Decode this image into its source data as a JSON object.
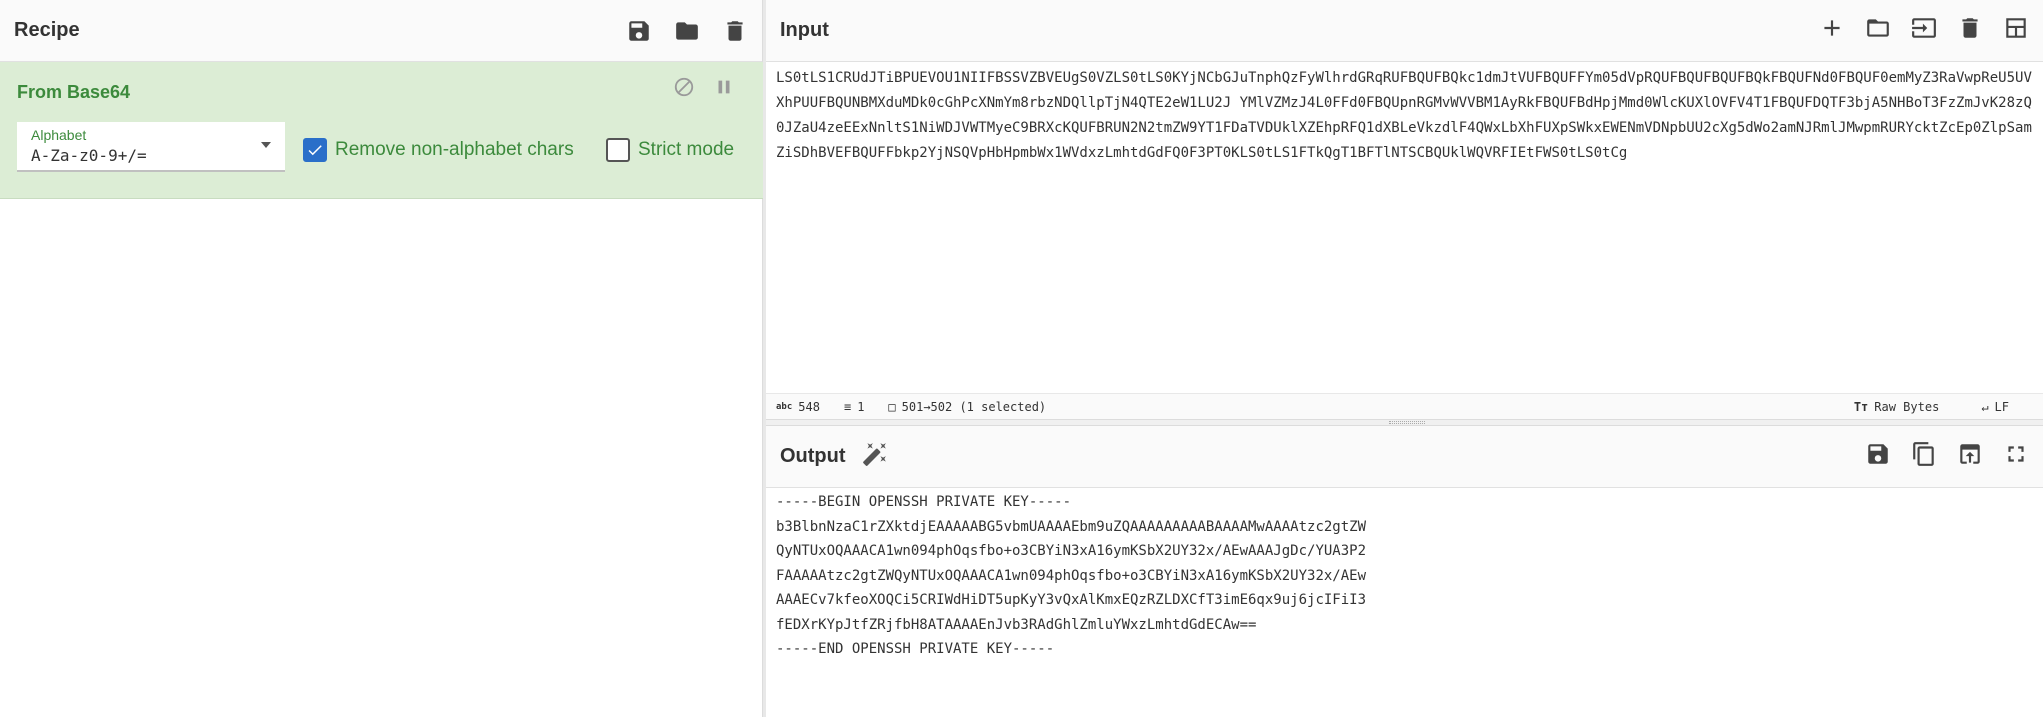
{
  "recipe": {
    "title": "Recipe",
    "operation": {
      "name": "From Base64",
      "alphabet_label": "Alphabet",
      "alphabet_value": "A-Za-z0-9+/=",
      "remove_non_alphabet_label": "Remove non-alphabet chars",
      "remove_non_alphabet_checked": true,
      "strict_mode_label": "Strict mode",
      "strict_mode_checked": false
    }
  },
  "input": {
    "title": "Input",
    "text": "LS0tLS1CRUdJTiBPUEVOU1NIIFBSSVZBVEUgS0VZLS0tLS0KYjNCbGJuTnphQzFyWlhrdGRqRUFBQUFBQkc1dmJtVUFBQUFFYm05dVpRQUFBQUFBQUFBQkFBQUFNd0FBQUF0emMyZ3RaVwpReU5UVXhPUUFBQUNBMXduMDk0cGhPcXNmYm8rbzNDQllpTjN4QTE2eW1LU2J YMlVZMzJ4L0FFd0FBQUpnRGMvWVVBM1AyRkFBQUFBdHpjMmd0WlcKUXlOVFV4T1FBQUFDQTF3bjA5NHBoT3FzZmJvK28zQ0JZaU4zeEExNnltS1NiWDJVWTMyeC9BRXcKQUFBRUN2N2tmZW9YT1FDaTVDUklXZEhpRFQ1dXBLeVkzdlF4QWxLbXhFUXpSWkxEWENmVDNpbUU2cXg5dWo2amNJRmlJMwpmRURYcktZcEp0ZlpSamZiSDhBVEFBQUFFbkp2YjNSQVpHbHpmbWx1WVdxzLmhtdGdFQ0F3PT0KLS0tLS1FTkQgT1BFTlNTSCBQUklWQVRFIEtFWS0tLS0tCg",
    "status": {
      "chars": "548",
      "lines": "1",
      "selection": "501→502 (1 selected)",
      "encoding": "Raw Bytes",
      "eol": "LF"
    }
  },
  "output": {
    "title": "Output",
    "text": "-----BEGIN OPENSSH PRIVATE KEY-----\nb3BlbnNzaC1rZXktdjEAAAAABG5vbmUAAAAEbm9uZQAAAAAAAAABAAAAMwAAAAtzc2gtZW\nQyNTUxOQAAACA1wn094phOqsfbo+o3CBYiN3xA16ymKSbX2UY32x/AEwAAAJgDc/YUA3P2\nFAAAAAtzc2gtZWQyNTUxOQAAACA1wn094phOqsfbo+o3CBYiN3xA16ymKSbX2UY32x/AEw\nAAAECv7kfeoXOQCi5CRIWdHiDT5upKyY3vQxAlKmxEQzRZLDXCfT3imE6qx9uj6jcIFiI3\nfEDXrKYpJtfZRjfbH8ATAAAAEnJvb3RAdGhlZmluYWxzLmhtdGdECAw==\n-----END OPENSSH PRIVATE KEY-----"
  }
}
